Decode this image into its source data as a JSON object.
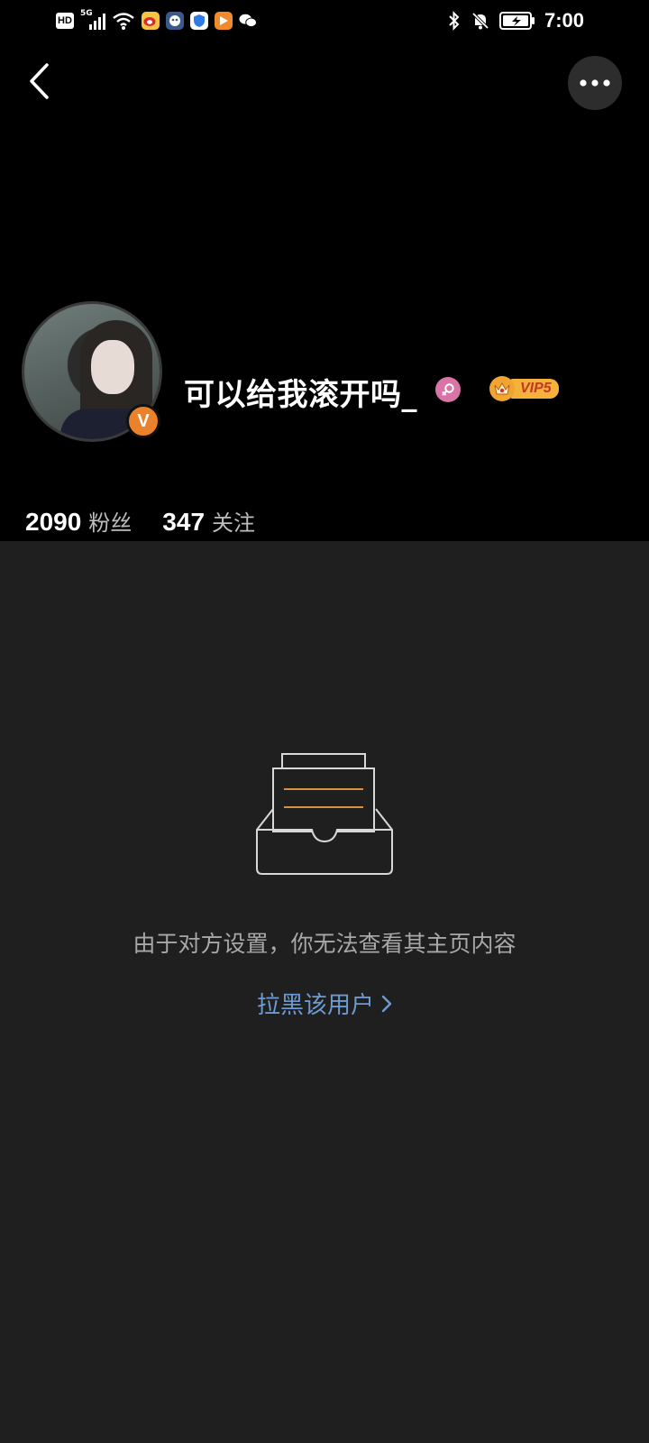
{
  "status_bar": {
    "hd_label": "HD",
    "network_label": "5G",
    "time": "7:00",
    "left_icons": [
      "hd-icon",
      "cellular-signal-icon",
      "wifi-icon",
      "weibo-app-icon",
      "bot-app-icon",
      "shield-app-icon",
      "video-app-icon",
      "wechat-app-icon"
    ],
    "right_icons": [
      "bluetooth-icon",
      "bell-muted-icon",
      "battery-charging-icon"
    ]
  },
  "nav": {
    "back_icon": "chevron-left-icon",
    "more_icon": "more-dots-icon"
  },
  "profile": {
    "username": "可以给我滚开吗_",
    "verify_mark": "V",
    "gender": "female",
    "vip_label": "VIP5",
    "followers_count": "2090",
    "followers_label": "粉丝",
    "following_count": "347",
    "following_label": "关注"
  },
  "empty_state": {
    "icon": "empty-inbox-icon",
    "message": "由于对方设置，你无法查看其主页内容",
    "block_link": "拉黑该用户"
  },
  "colors": {
    "header_bg": "#000000",
    "body_bg": "#1f1f1f",
    "link": "#6c9bd2",
    "verify": "#e9822b",
    "vip": "#f4b23c",
    "female": "#d975a6"
  }
}
